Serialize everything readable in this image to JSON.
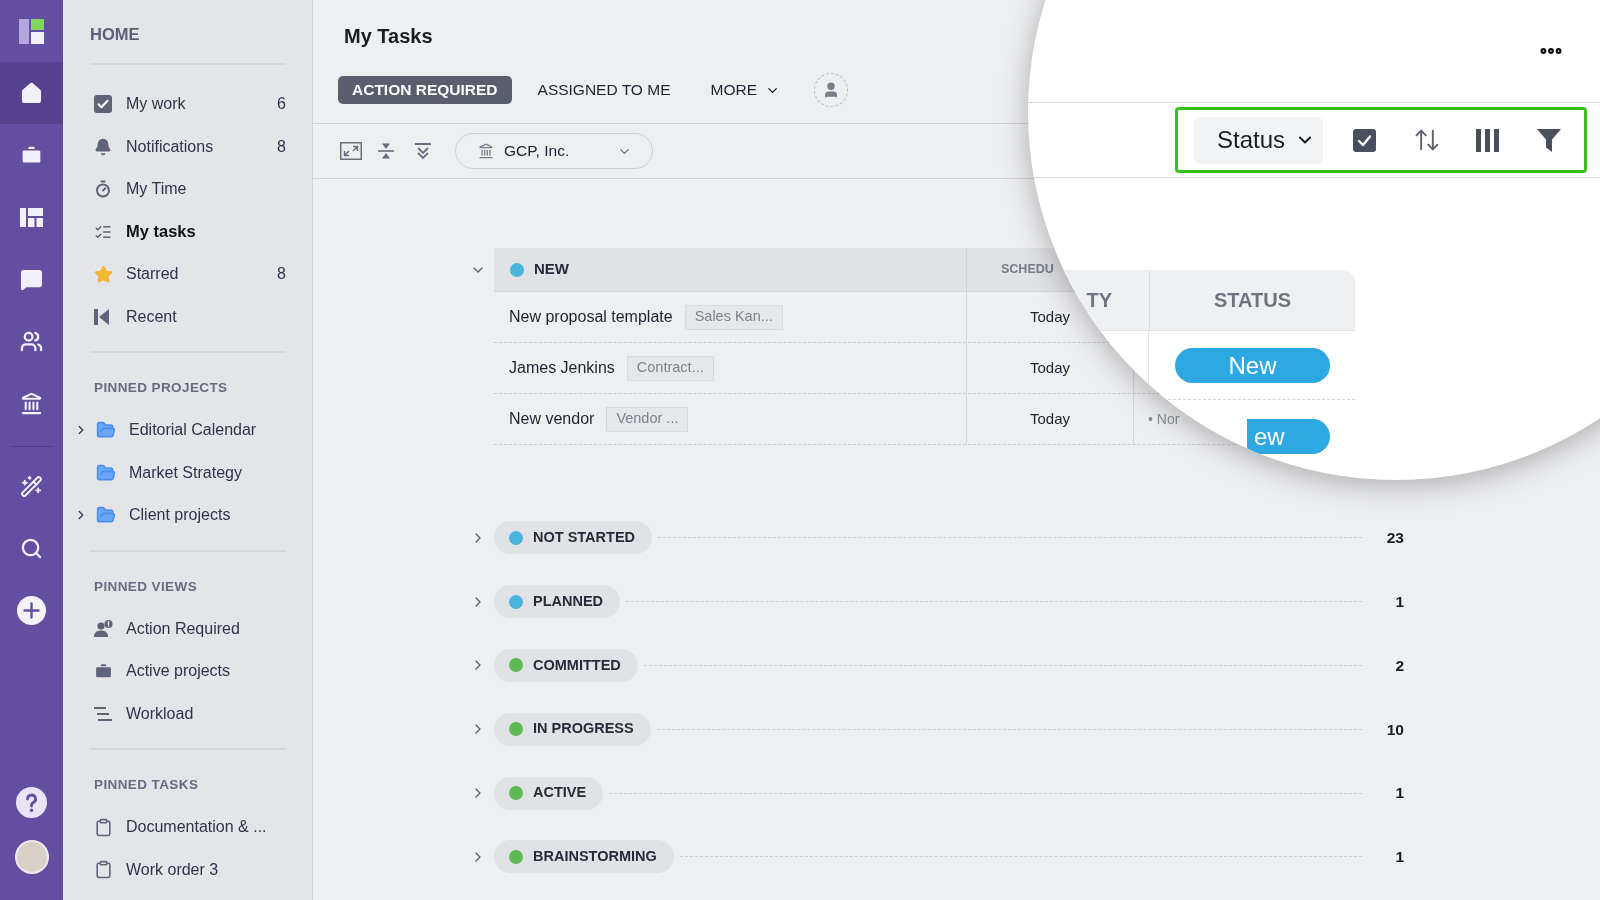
{
  "rail": {
    "nav": [
      {
        "selected": true
      },
      {
        "selected": false
      },
      {
        "selected": false
      },
      {
        "selected": false
      },
      {
        "selected": false
      },
      {
        "selected": false
      }
    ]
  },
  "sidebar": {
    "title": "HOME",
    "items": [
      {
        "label": "My work",
        "count": "6",
        "selected": false
      },
      {
        "label": "Notifications",
        "count": "8",
        "selected": false
      },
      {
        "label": "My Time",
        "selected": false
      },
      {
        "label": "My tasks",
        "selected": true
      },
      {
        "label": "Starred",
        "count": "8",
        "selected": false
      },
      {
        "label": "Recent",
        "selected": false
      }
    ],
    "sections": [
      {
        "kind": "projects",
        "title": "PINNED PROJECTS",
        "items": [
          {
            "label": "Editorial Calendar",
            "expandable": true,
            "selected": false
          },
          {
            "label": "Market Strategy",
            "expandable": false,
            "selected": false
          },
          {
            "label": "Client projects",
            "expandable": true,
            "selected": false
          }
        ]
      },
      {
        "kind": "views",
        "title": "PINNED VIEWS",
        "items": [
          {
            "label": "Action Required",
            "selected": false
          },
          {
            "label": "Active projects",
            "selected": false
          },
          {
            "label": "Workload",
            "selected": false
          }
        ]
      },
      {
        "kind": "tasks",
        "title": "PINNED TASKS",
        "items": [
          {
            "label": "Documentation & ...",
            "selected": false
          },
          {
            "label": "Work order 3",
            "selected": false
          }
        ]
      }
    ]
  },
  "header": {
    "title": "My Tasks",
    "tabs": [
      {
        "kind": "tab",
        "label": "ACTION REQUIRED",
        "selected": true
      },
      {
        "kind": "tab",
        "label": "ASSIGNED TO ME",
        "selected": false
      },
      {
        "kind": "menu",
        "label": "MORE",
        "selected": false
      }
    ]
  },
  "toolbar": {
    "workspace": "GCP, Inc."
  },
  "groups": [
    {
      "label": "NEW",
      "color": "#4ab4dd",
      "expanded": true,
      "columns": {
        "column_2": "SCHEDU"
      },
      "rows": [
        {
          "name": "New proposal template",
          "tag": "Sales Kan...",
          "column_2": "Today"
        },
        {
          "name": "James Jenkins",
          "tag": "Contract...",
          "column_2": "Today"
        },
        {
          "name": "New vendor",
          "tag": "Vendor ...",
          "column_2": "Today",
          "column_3": "• Nor"
        }
      ]
    },
    {
      "label": "NOT STARTED",
      "color": "#4ab4dd",
      "expanded": false,
      "count": "23"
    },
    {
      "label": "PLANNED",
      "color": "#4ab4dd",
      "expanded": false,
      "count": "1"
    },
    {
      "label": "COMMITTED",
      "color": "#5cba52",
      "expanded": false,
      "count": "2"
    },
    {
      "label": "IN PROGRESS",
      "color": "#5cba52",
      "expanded": false,
      "count": "10"
    },
    {
      "label": "ACTIVE",
      "color": "#5cba52",
      "expanded": false,
      "count": "1"
    },
    {
      "label": "BRAINSTORMING",
      "color": "#5cba52",
      "expanded": false,
      "count": "1"
    }
  ],
  "magnifier": {
    "toolbar": {
      "group_by": "Status"
    },
    "table": {
      "columns": [
        {
          "label": "TY"
        },
        {
          "label": "STATUS"
        }
      ],
      "rows": [
        {
          "status": "New"
        },
        {
          "status": "ew"
        }
      ]
    }
  }
}
